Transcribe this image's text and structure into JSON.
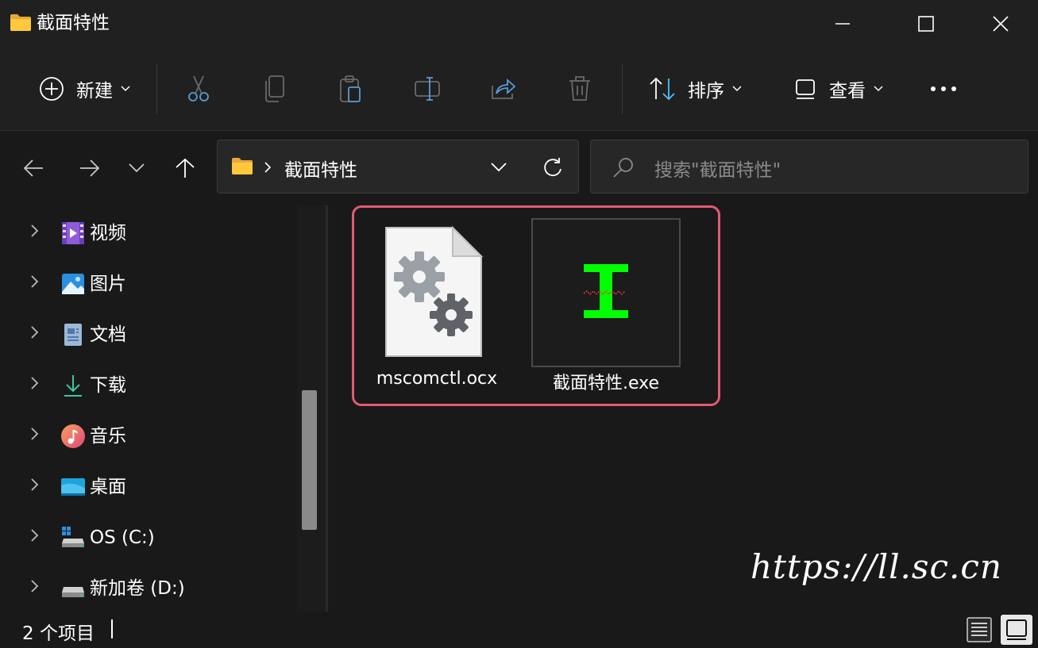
{
  "window": {
    "title": "截面特性",
    "min_label": "minimize",
    "max_label": "maximize",
    "close_label": "close"
  },
  "toolbar": {
    "new_label": "新建",
    "sort_label": "排序",
    "view_label": "查看",
    "more_label": "•••"
  },
  "address": {
    "path": "截面特性",
    "separator": "›"
  },
  "search": {
    "placeholder": "搜索\"截面特性\""
  },
  "sidebar": {
    "items": [
      {
        "label": "视频",
        "icon": "video-icon"
      },
      {
        "label": "图片",
        "icon": "pictures-icon"
      },
      {
        "label": "文档",
        "icon": "documents-icon"
      },
      {
        "label": "下载",
        "icon": "download-icon"
      },
      {
        "label": "音乐",
        "icon": "music-icon"
      },
      {
        "label": "桌面",
        "icon": "desktop-icon"
      },
      {
        "label": "OS (C:)",
        "icon": "drive-c-icon"
      },
      {
        "label": "新加卷 (D:)",
        "icon": "drive-d-icon"
      }
    ]
  },
  "files": [
    {
      "name": "mscomctl.ocx",
      "icon": "ocx-file-icon"
    },
    {
      "name": "截面特性.exe",
      "icon": "exe-app-icon"
    }
  ],
  "status": {
    "count": "2 个项目"
  },
  "watermark": {
    "text": "https://ll.sc.cn"
  },
  "colors": {
    "selection": "#e25b72",
    "accent_blue": "#4cc2ff",
    "exe_green": "#00ff00"
  }
}
